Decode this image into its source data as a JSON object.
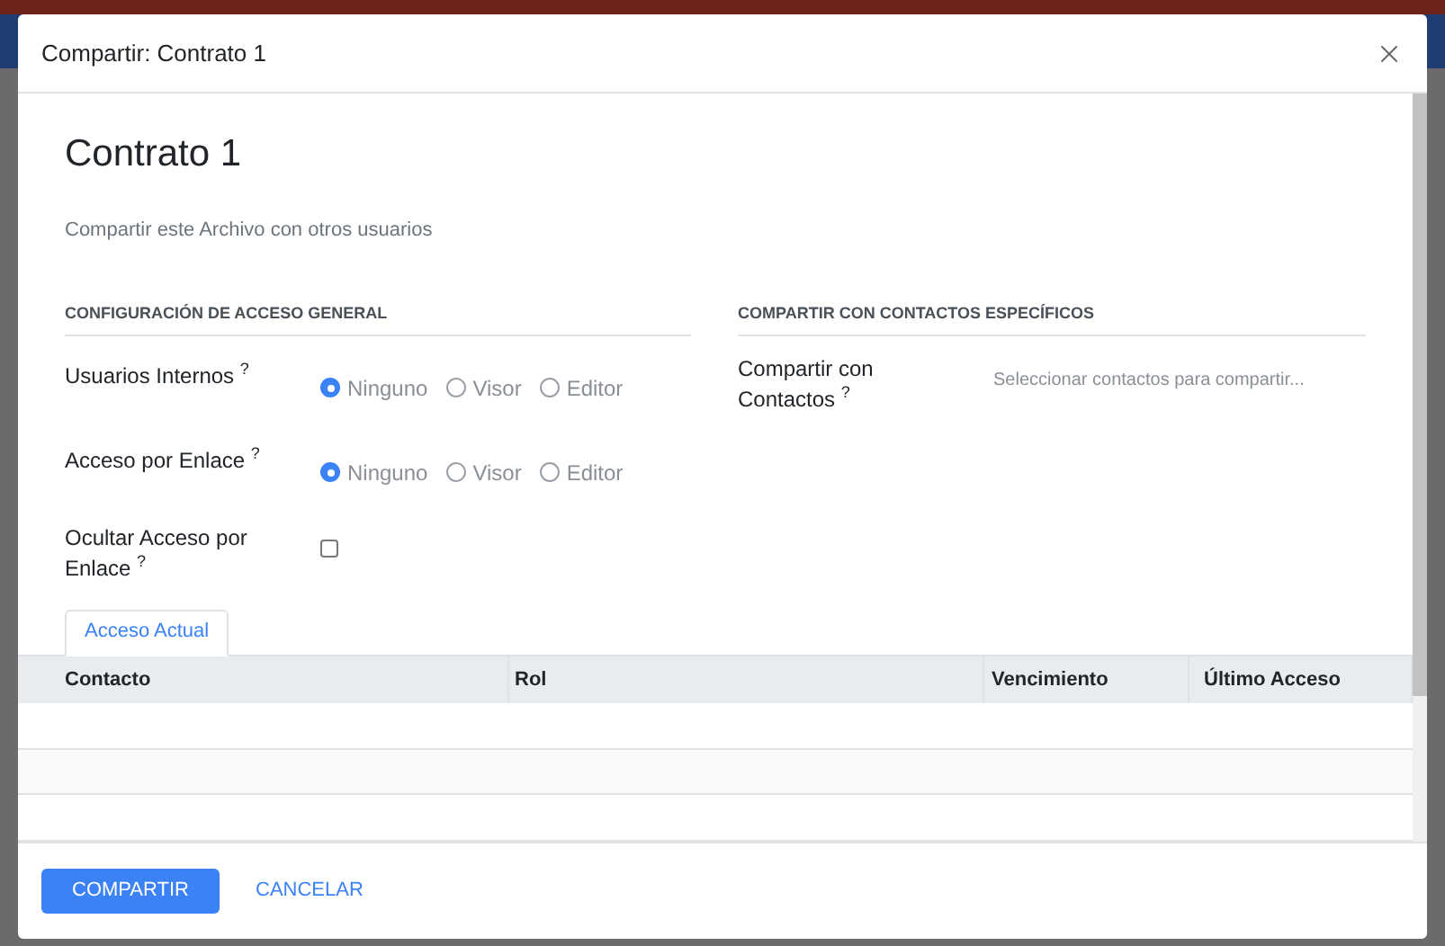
{
  "dialog": {
    "title": "Compartir: Contrato 1"
  },
  "record": {
    "name": "Contrato 1",
    "description": "Compartir este Archivo con otros usuarios"
  },
  "general_access": {
    "heading": "CONFIGURACIÓN DE ACCESO GENERAL",
    "fields": [
      {
        "kind": "radio",
        "label": "Usuarios Internos $^{?}$",
        "options": [
          {
            "label": "Ninguno",
            "selected": true
          },
          {
            "label": "Visor",
            "selected": false
          },
          {
            "label": "Editor",
            "selected": false
          }
        ]
      },
      {
        "kind": "radio",
        "label": "Acceso por Enlace $^{?}$",
        "options": [
          {
            "label": "Ninguno",
            "selected": true
          },
          {
            "label": "Visor",
            "selected": false
          },
          {
            "label": "Editor",
            "selected": false
          }
        ]
      },
      {
        "kind": "checkbox",
        "label": "Ocultar Acceso por Enlace $^{?}$",
        "checked": false
      }
    ]
  },
  "specific_contacts": {
    "heading": "COMPARTIR CON CONTACTOS ESPECÍFICOS",
    "label": "Compartir con Contactos $^{?}$",
    "placeholder": "Seleccionar contactos para compartir..."
  },
  "tabs": [
    {
      "label": "Acceso Actual",
      "selected": true
    }
  ],
  "table": {
    "columns": [
      "Contacto",
      "Rol",
      "Vencimiento",
      "Último Acceso"
    ]
  },
  "buttons": [
    {
      "label": "COMPARTIR",
      "kind": "primary"
    },
    {
      "label": "CANCELAR",
      "kind": "link"
    }
  ]
}
